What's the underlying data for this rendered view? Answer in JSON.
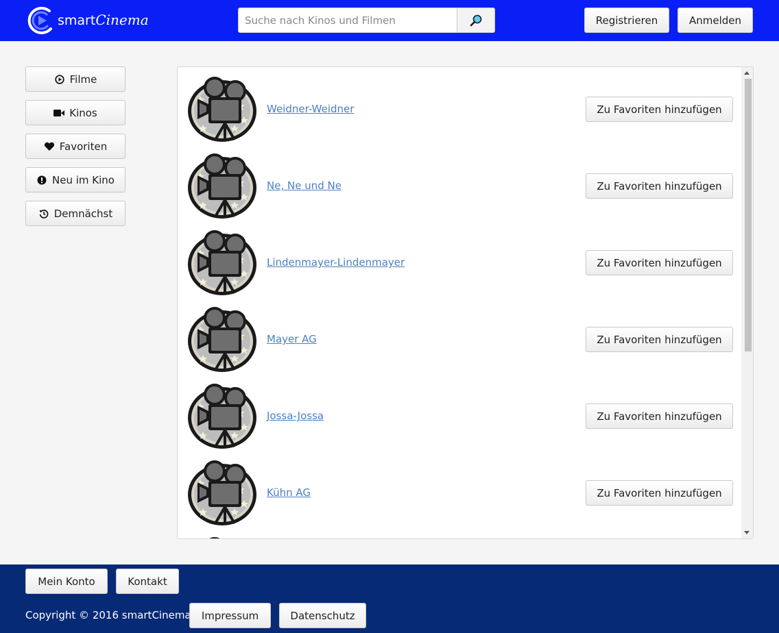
{
  "header": {
    "brand_prefix": "smart",
    "brand_suffix": "Cinema",
    "search_placeholder": "Suche nach Kinos und Filmen",
    "register_label": "Registrieren",
    "login_label": "Anmelden"
  },
  "sidebar": {
    "items": [
      {
        "label": "Filme",
        "icon": "play-circle-icon"
      },
      {
        "label": "Kinos",
        "icon": "video-camera-icon"
      },
      {
        "label": "Favoriten",
        "icon": "heart-icon"
      },
      {
        "label": "Neu im Kino",
        "icon": "exclamation-icon"
      },
      {
        "label": "Demnächst",
        "icon": "history-icon"
      }
    ]
  },
  "cinemas": {
    "fav_label": "Zu Favoriten hinzufügen",
    "items": [
      {
        "name": "Weidner-Weidner"
      },
      {
        "name": "Ne, Ne und Ne"
      },
      {
        "name": "Lindenmayer-Lindenmayer"
      },
      {
        "name": "Mayer AG"
      },
      {
        "name": "Jossa-Jossa"
      },
      {
        "name": "Kühn AG"
      }
    ]
  },
  "footer": {
    "account_label": "Mein Konto",
    "contact_label": "Kontakt",
    "copyright": "Copyright © 2016 smartCinema",
    "imprint_label": "Impressum",
    "privacy_label": "Datenschutz"
  },
  "colors": {
    "header_bg": "#0a1ff5",
    "footer_bg": "#072a77",
    "link": "#4c7fc4"
  }
}
